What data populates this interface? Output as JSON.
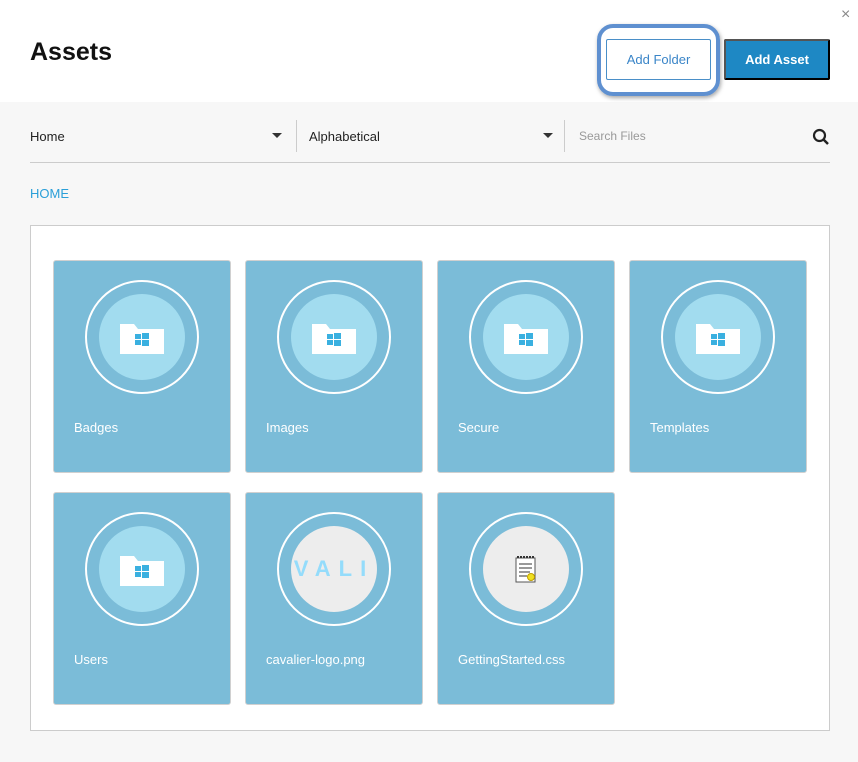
{
  "header": {
    "title": "Assets",
    "add_folder": "Add Folder",
    "add_asset": "Add Asset",
    "close": "×"
  },
  "filters": {
    "folder": "Home",
    "sort": "Alphabetical",
    "search_placeholder": "Search Files"
  },
  "breadcrumb": "HOME",
  "items": [
    {
      "name": "Badges",
      "type": "folder"
    },
    {
      "name": "Images",
      "type": "folder"
    },
    {
      "name": "Secure",
      "type": "folder"
    },
    {
      "name": "Templates",
      "type": "folder"
    },
    {
      "name": "Users",
      "type": "folder"
    },
    {
      "name": "cavalier-logo.png",
      "type": "image",
      "preview_text": "VALI"
    },
    {
      "name": "GettingStarted.css",
      "type": "file"
    }
  ]
}
